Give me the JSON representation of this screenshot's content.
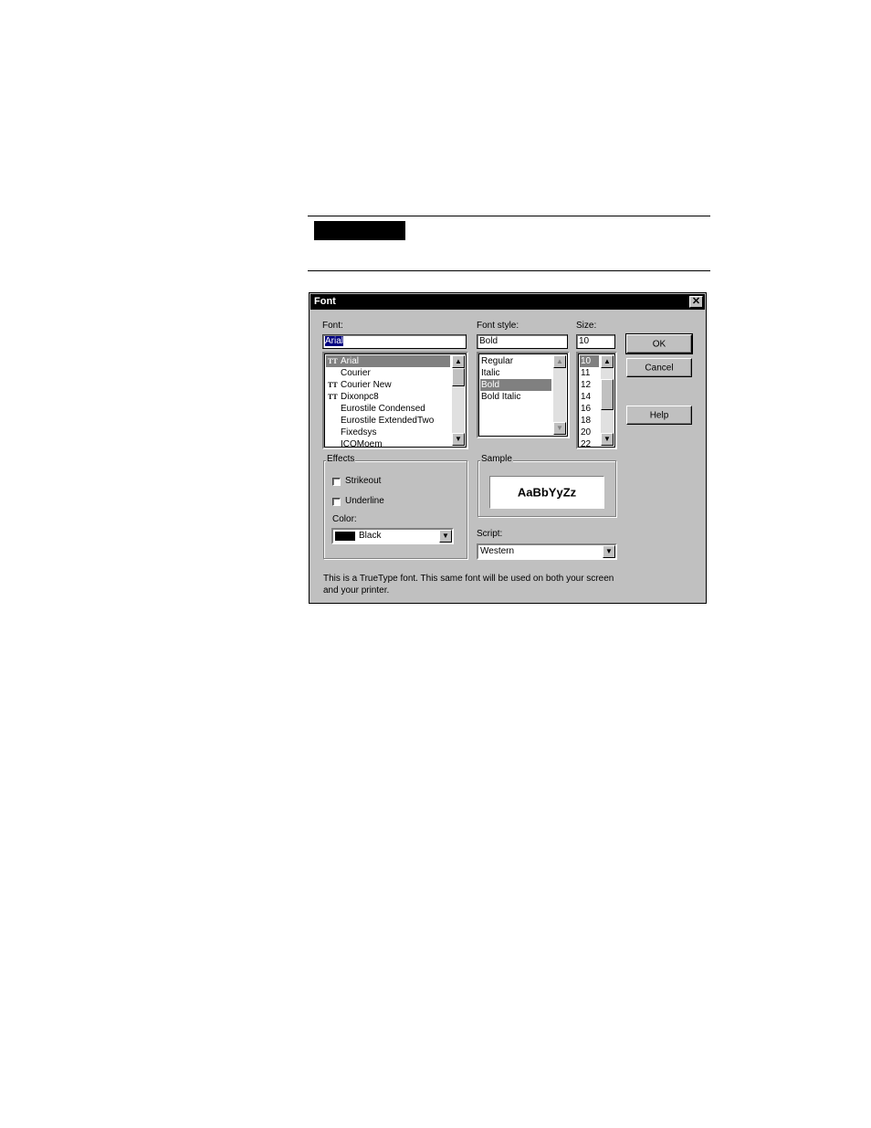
{
  "window": {
    "title": "Font",
    "close_glyph": "✕"
  },
  "font": {
    "label": "Font:",
    "value": "Arial",
    "items": [
      {
        "name": "Arial",
        "truetype": true,
        "selected": true
      },
      {
        "name": "Courier",
        "truetype": false
      },
      {
        "name": "Courier New",
        "truetype": true
      },
      {
        "name": "Dixonpc8",
        "truetype": true
      },
      {
        "name": "Eurostile Condensed",
        "truetype": false
      },
      {
        "name": "Eurostile ExtendedTwo",
        "truetype": false
      },
      {
        "name": "Fixedsys",
        "truetype": false
      },
      {
        "name": "ICOMoem",
        "truetype": false
      }
    ]
  },
  "font_style": {
    "label": "Font style:",
    "value": "Bold",
    "items": [
      "Regular",
      "Italic",
      "Bold",
      "Bold Italic"
    ],
    "selected_index": 2
  },
  "size": {
    "label": "Size:",
    "value": "10",
    "items": [
      "10",
      "11",
      "12",
      "14",
      "16",
      "18",
      "20",
      "22"
    ],
    "selected_index": 0
  },
  "buttons": {
    "ok": "OK",
    "cancel": "Cancel",
    "help": "Help"
  },
  "effects": {
    "label": "Effects",
    "strikeout": {
      "label": "Strikeout",
      "checked": false
    },
    "underline": {
      "label": "Underline",
      "checked": false
    },
    "color_label": "Color:",
    "color_value": "Black",
    "color_swatch": "#000000"
  },
  "sample": {
    "label": "Sample",
    "text": "AaBbYyZz"
  },
  "script": {
    "label": "Script:",
    "value": "Western"
  },
  "note": "This is a TrueType font. This same font will be used on both your screen and your printer.",
  "icons": {
    "truetype": "TT",
    "up": "▲",
    "down": "▼"
  }
}
